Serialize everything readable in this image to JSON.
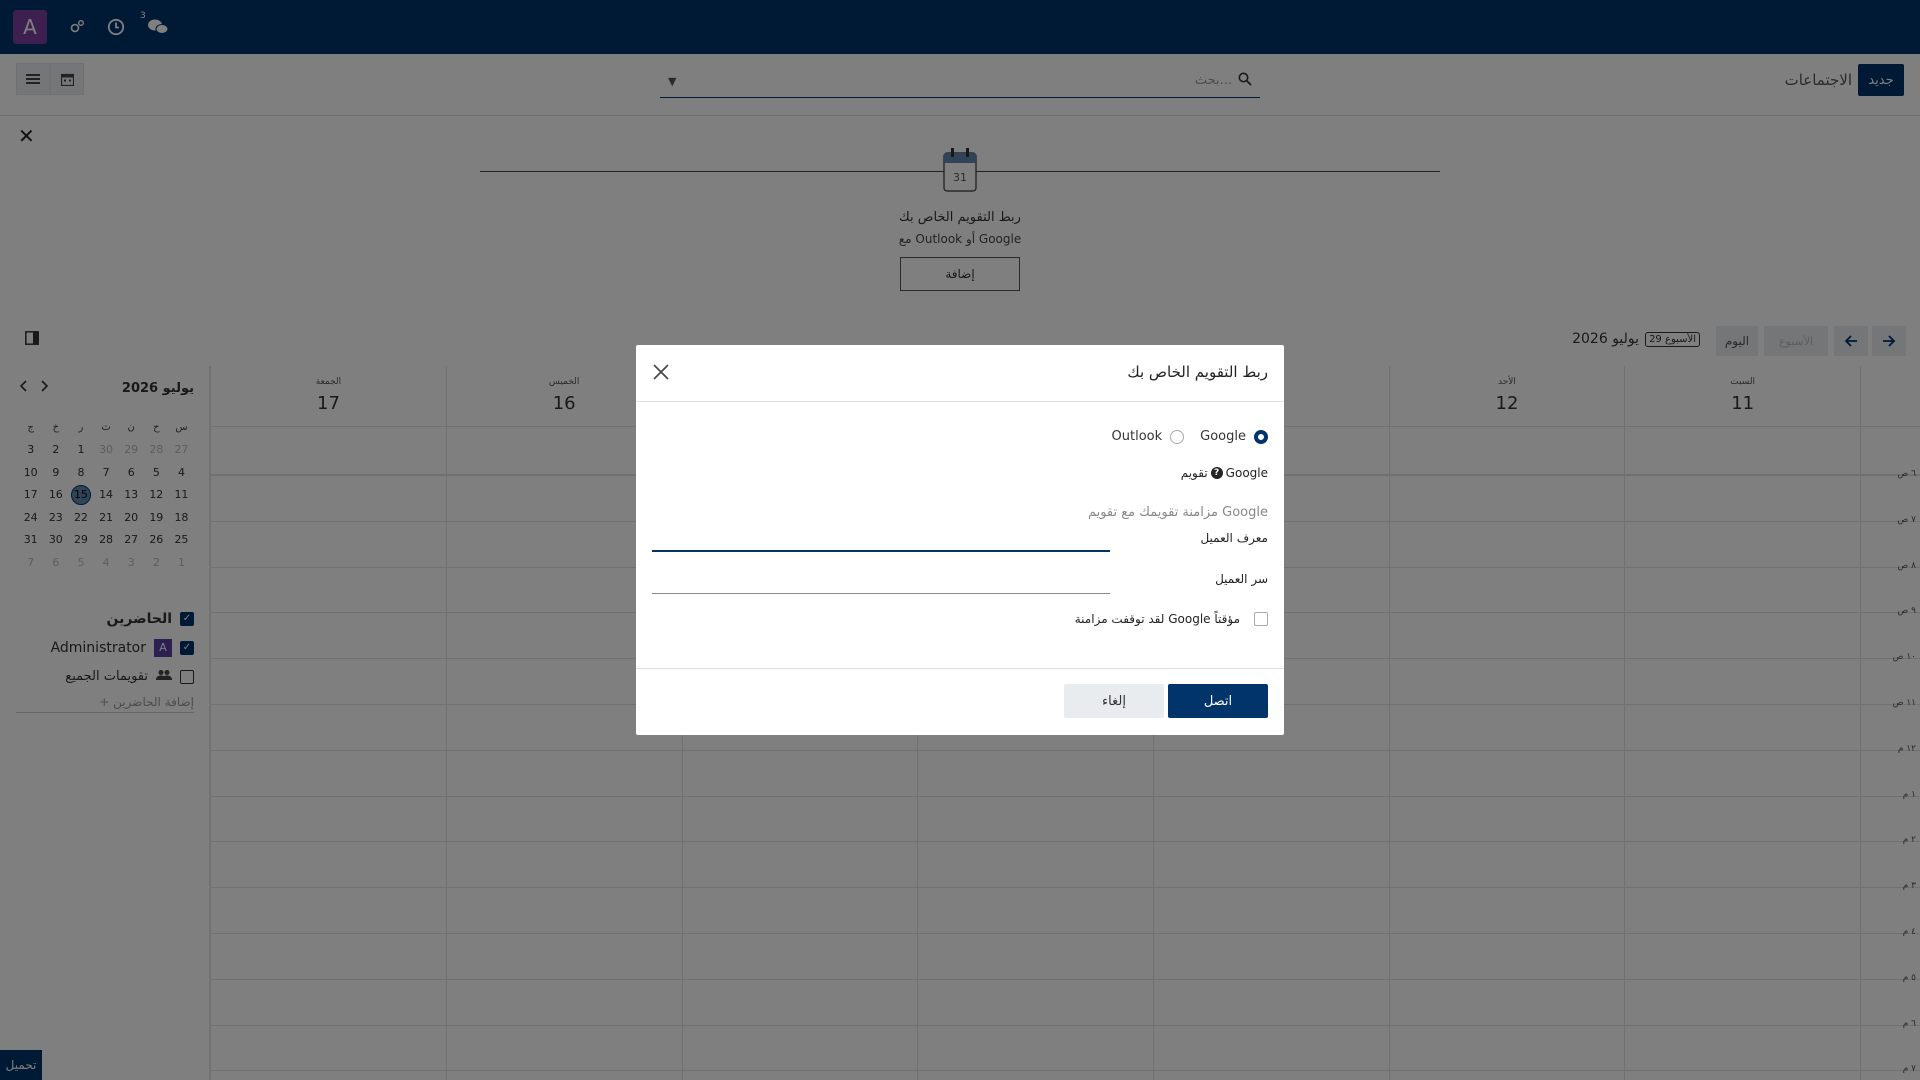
{
  "navbar": {
    "avatar_letter": "A",
    "message_count": "3"
  },
  "control": {
    "new_button": "جديد",
    "title": "الاجتماعات",
    "search_placeholder": "بحث..."
  },
  "banner": {
    "line1": "ربط التقويم الخاص بك",
    "line2": "مع Outlook أو Google",
    "add_button": "إضافة",
    "calendar_icon_number": "31"
  },
  "toolbar": {
    "today": "اليوم",
    "range": "الأسبوع",
    "month_year": "يوليو 2026",
    "week_badge": "الأسبوع 29"
  },
  "mini_calendar": {
    "title": "يوليو 2026",
    "weekdays": [
      "س",
      "ح",
      "ن",
      "ث",
      "ر",
      "خ",
      "ج"
    ],
    "weeks": [
      [
        {
          "d": "27",
          "dim": true
        },
        {
          "d": "28",
          "dim": true
        },
        {
          "d": "29",
          "dim": true
        },
        {
          "d": "30",
          "dim": true
        },
        {
          "d": "1"
        },
        {
          "d": "2"
        },
        {
          "d": "3"
        }
      ],
      [
        {
          "d": "4"
        },
        {
          "d": "5"
        },
        {
          "d": "6"
        },
        {
          "d": "7"
        },
        {
          "d": "8"
        },
        {
          "d": "9"
        },
        {
          "d": "10"
        }
      ],
      [
        {
          "d": "11"
        },
        {
          "d": "12"
        },
        {
          "d": "13"
        },
        {
          "d": "14"
        },
        {
          "d": "15",
          "today": true
        },
        {
          "d": "16"
        },
        {
          "d": "17"
        }
      ],
      [
        {
          "d": "18"
        },
        {
          "d": "19"
        },
        {
          "d": "20"
        },
        {
          "d": "21"
        },
        {
          "d": "22"
        },
        {
          "d": "23"
        },
        {
          "d": "24"
        }
      ],
      [
        {
          "d": "25"
        },
        {
          "d": "26"
        },
        {
          "d": "27"
        },
        {
          "d": "28"
        },
        {
          "d": "29"
        },
        {
          "d": "30"
        },
        {
          "d": "31"
        }
      ],
      [
        {
          "d": "1",
          "dim": true
        },
        {
          "d": "2",
          "dim": true
        },
        {
          "d": "3",
          "dim": true
        },
        {
          "d": "4",
          "dim": true
        },
        {
          "d": "5",
          "dim": true
        },
        {
          "d": "6",
          "dim": true
        },
        {
          "d": "7",
          "dim": true
        }
      ]
    ]
  },
  "attendees": {
    "attendees_label": "الحاضرين",
    "admin_name": "Administrator",
    "admin_letter": "A",
    "everybody": "تقويمات الجميع",
    "add_attendees": "+ إضافة الحاضرين"
  },
  "week_days": [
    {
      "dow": "السبت",
      "num": "11"
    },
    {
      "dow": "الأحد",
      "num": "12"
    },
    {
      "dow": "",
      "num": ""
    },
    {
      "dow": "",
      "num": ""
    },
    {
      "dow": "",
      "num": ""
    },
    {
      "dow": "الخميس",
      "num": "16"
    },
    {
      "dow": "الجمعة",
      "num": "17"
    }
  ],
  "hours": [
    "٦ ص",
    "٧ ص",
    "٨ ص",
    "٩ ص",
    "١٠ ص",
    "١١ ص",
    "١٢ م",
    "١ م",
    "٢ م",
    "٣ م",
    "٤ م",
    "٥ م",
    "٦ م",
    "٧ م"
  ],
  "dialog": {
    "title": "ربط التقويم الخاص بك",
    "option_google": "Google",
    "option_outlook": "Outlook",
    "selected": "Google",
    "gcal_label_prefix": "تقويم",
    "gcal_label_brand": "Google",
    "description": "مزامنة تقويمك مع تقويم Google",
    "client_id_label": "معرف العميل",
    "client_id_value": "",
    "client_secret_label": "سر العميل",
    "client_secret_value": "",
    "paused_label": "لقد توقفت مزامنة Google مؤقتاً",
    "connect_button": "اتصل",
    "cancel_button": "إلغاء"
  },
  "footer": {
    "load_label": "تحميل"
  },
  "colors": {
    "brand": "#00346b",
    "avatar": "#7b3fa0"
  }
}
